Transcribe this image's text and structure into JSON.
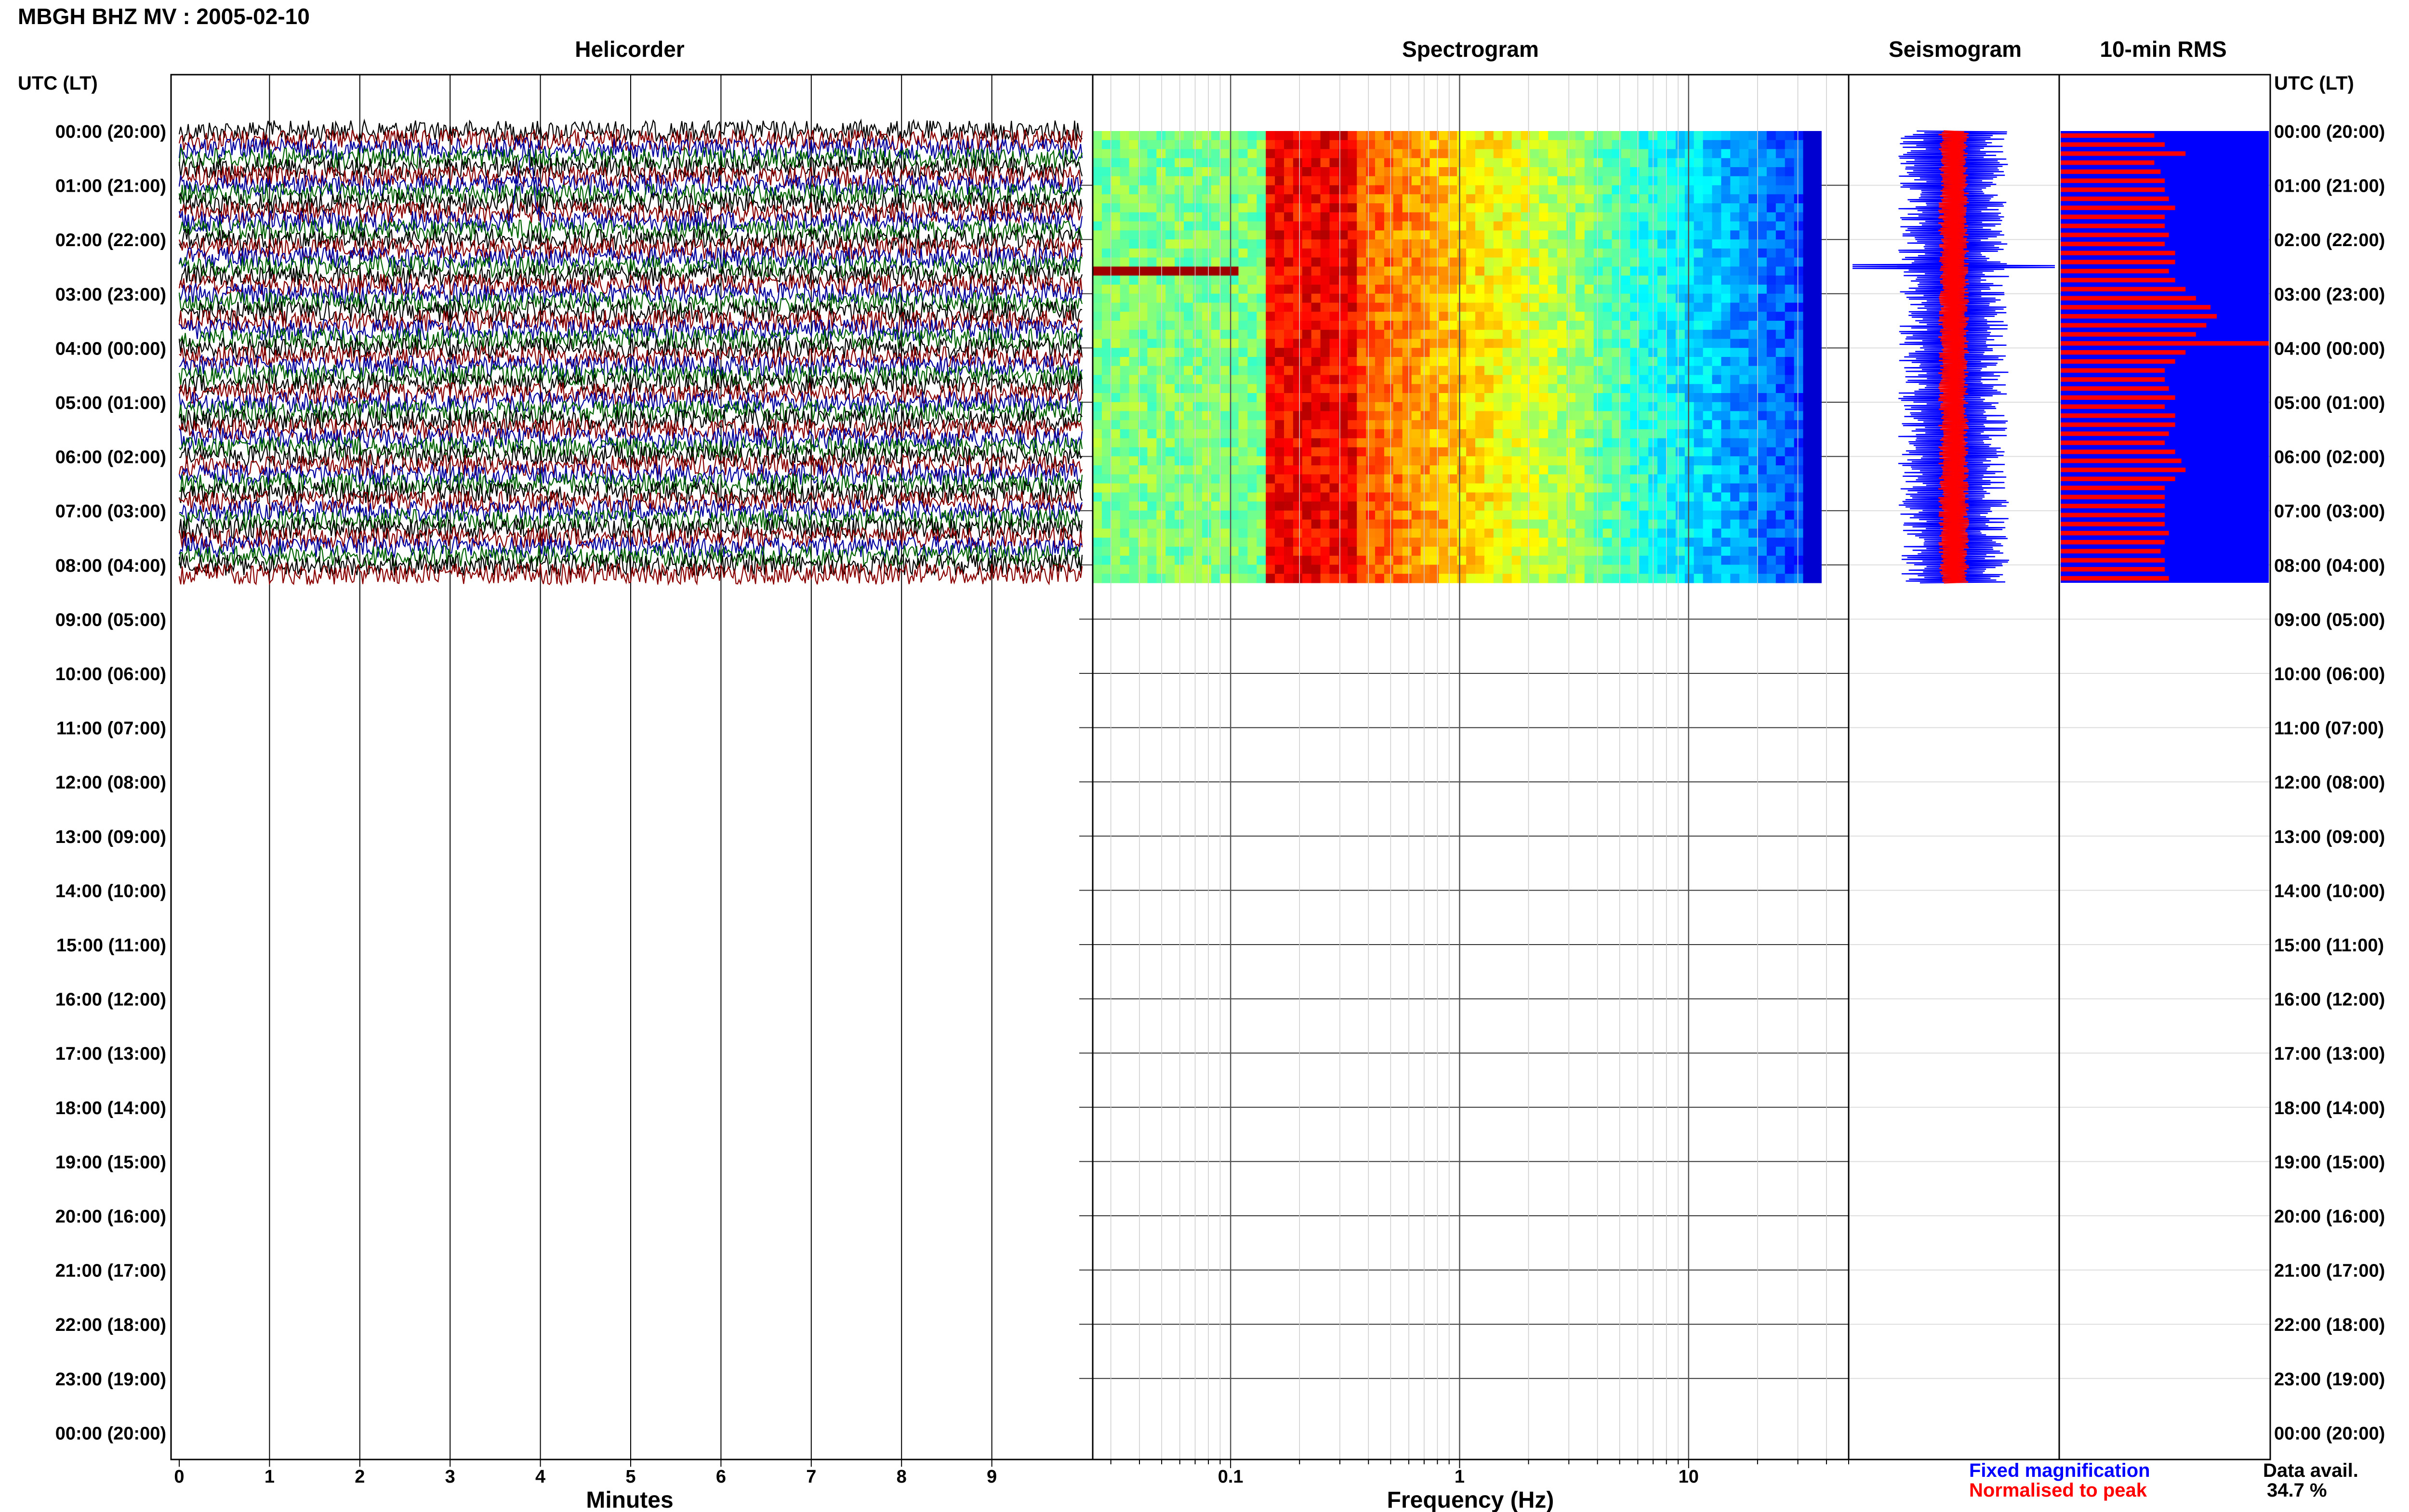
{
  "header": {
    "title": "MBGH BHZ MV : 2005-02-10"
  },
  "panels": {
    "helicorder": "Helicorder",
    "spectrogram": "Spectrogram",
    "seismogram": "Seismogram",
    "rms": "10-min RMS"
  },
  "time_axis": {
    "header_left": "UTC (LT)",
    "header_right": "UTC (LT)",
    "labels": [
      "00:00 (20:00)",
      "01:00 (21:00)",
      "02:00 (22:00)",
      "03:00 (23:00)",
      "04:00 (00:00)",
      "05:00 (01:00)",
      "06:00 (02:00)",
      "07:00 (03:00)",
      "08:00 (04:00)",
      "09:00 (05:00)",
      "10:00 (06:00)",
      "11:00 (07:00)",
      "12:00 (08:00)",
      "13:00 (09:00)",
      "14:00 (10:00)",
      "15:00 (11:00)",
      "16:00 (12:00)",
      "17:00 (13:00)",
      "18:00 (14:00)",
      "19:00 (15:00)",
      "20:00 (16:00)",
      "21:00 (17:00)",
      "22:00 (18:00)",
      "23:00 (19:00)",
      "00:00 (20:00)"
    ]
  },
  "legend": {
    "fixed": "Fixed magnification",
    "normalised": "Normalised to peak",
    "fixed_color": "#0000ff",
    "normalised_color": "#ff0000",
    "avail_label": "Data avail.",
    "avail_value": "34.7 %"
  },
  "chart_data": [
    {
      "type": "line",
      "panel": "helicorder",
      "xlabel": "Minutes",
      "xticks": [
        0,
        1,
        2,
        3,
        4,
        5,
        6,
        7,
        8,
        9
      ],
      "xlim": [
        0,
        10
      ],
      "trace_colors": [
        "#000000",
        "#8b0000",
        "#0000a0",
        "#006400"
      ],
      "rows_with_data_hours": 8.33
    },
    {
      "type": "heatmap",
      "panel": "spectrogram",
      "xlabel": "Frequency (Hz)",
      "xscale": "log",
      "xticks": [
        0.1,
        1,
        10
      ],
      "xlim": [
        0.025,
        50
      ],
      "colormap": "jet"
    },
    {
      "type": "area",
      "panel": "seismogram",
      "series": [
        {
          "name": "Fixed magnification",
          "color": "#0000ff"
        },
        {
          "name": "Normalised to peak",
          "color": "#ff0000"
        }
      ]
    },
    {
      "type": "bar",
      "panel": "rms",
      "orientation": "horizontal",
      "series": [
        {
          "name": "Fixed magnification",
          "color": "#0000ff"
        },
        {
          "name": "Normalised to peak",
          "color": "#ff0000"
        }
      ],
      "values": [
        0.45,
        0.5,
        0.6,
        0.45,
        0.48,
        0.5,
        0.5,
        0.52,
        0.55,
        0.5,
        0.5,
        0.52,
        0.5,
        0.55,
        0.55,
        0.52,
        0.55,
        0.6,
        0.65,
        0.72,
        0.75,
        0.7,
        0.65,
        1.0,
        0.6,
        0.55,
        0.5,
        0.5,
        0.52,
        0.55,
        0.5,
        0.55,
        0.55,
        0.52,
        0.5,
        0.55,
        0.58,
        0.6,
        0.55,
        0.5,
        0.5,
        0.5,
        0.5,
        0.5,
        0.52,
        0.5,
        0.48,
        0.5,
        0.5,
        0.52
      ]
    }
  ]
}
